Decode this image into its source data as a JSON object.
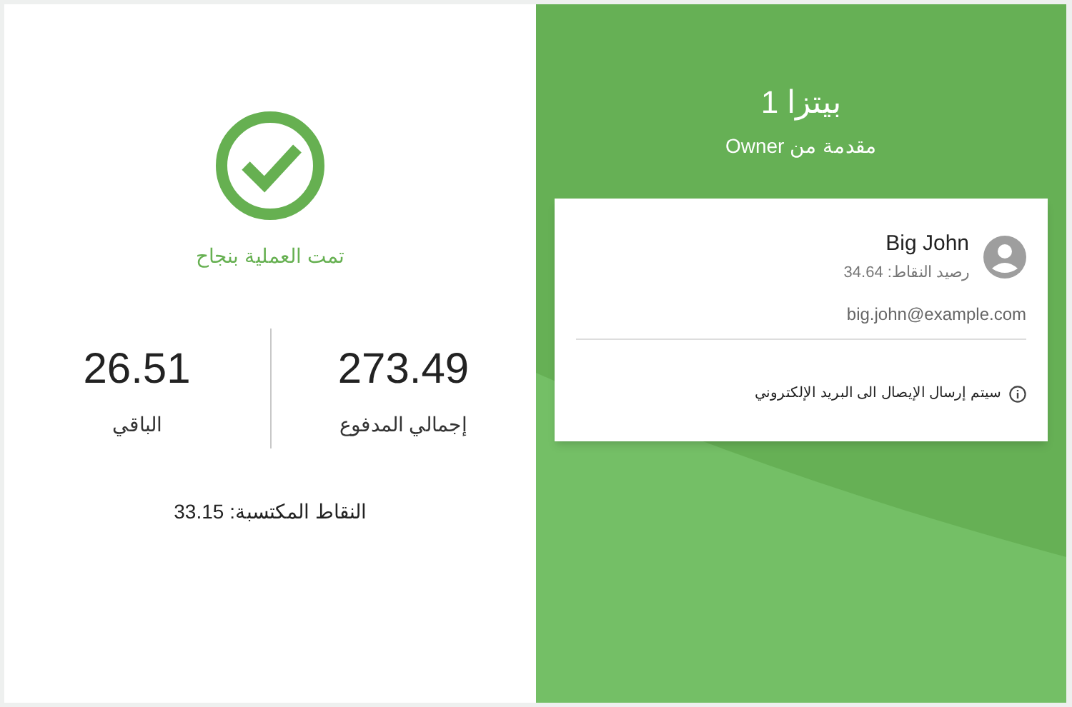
{
  "receipt": {
    "status": "تمت العملية بنجاح",
    "stats": [
      {
        "value": "273.49",
        "label": "إجمالي المدفوع"
      },
      {
        "value": "26.51",
        "label": "الباقي"
      }
    ],
    "points_earned": "النقاط المكتسبة: 33.15"
  },
  "order": {
    "title": "بيتزا 1",
    "subtitle": "مقدمة من Owner"
  },
  "customer": {
    "name": "Big John",
    "points_balance": "رصيد النقاط: 34.64",
    "email": "big.john@example.com",
    "notice": "سيتم إرسال الإيصال الى البريد الإلكتروني"
  }
}
